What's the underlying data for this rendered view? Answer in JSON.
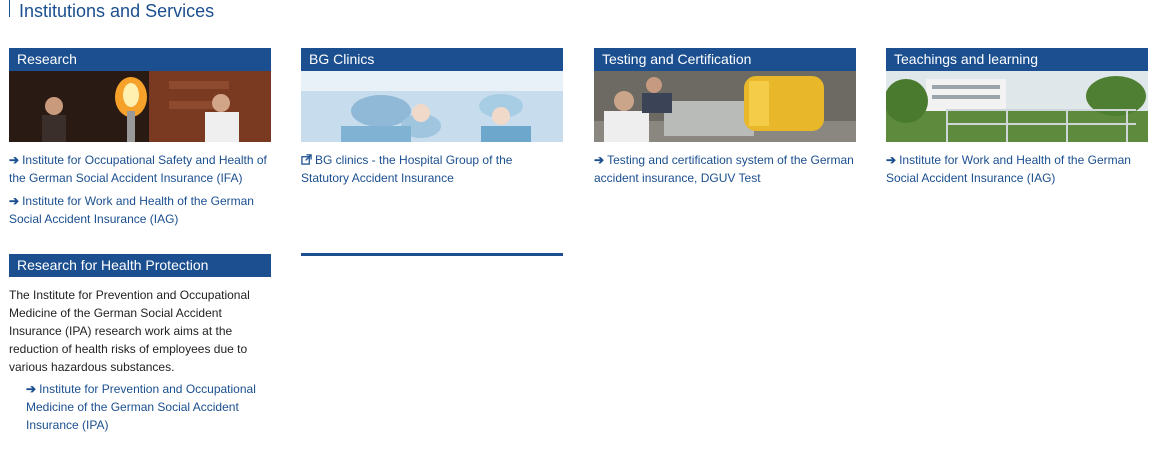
{
  "section": {
    "title": "Institutions and Services"
  },
  "cards": [
    {
      "title": "Research",
      "links": [
        "Institute for Occupational Safety and Health of the German Social Accident Insurance (IFA)",
        "Institute for Work and Health of the German Social Accident Insurance (IAG)"
      ]
    },
    {
      "title": "BG Clinics",
      "links": [
        "BG clinics - the Hospital Group of the Statutory Accident Insurance"
      ]
    },
    {
      "title": "Testing and Certification",
      "links": [
        "Testing and certification system of the German accident insurance, DGUV Test"
      ]
    },
    {
      "title": "Teachings and learning",
      "links": [
        "Institute for Work and Health of the German Social Accident Insurance (IAG)"
      ]
    }
  ],
  "health": {
    "title": "Research for Health Protection",
    "description": "The Institute for Prevention and Occupational Medicine of the German Social Accident Insurance (IPA) research work aims at the reduction of health risks of employees due to various hazardous substances.",
    "link": "Institute for Prevention and Occupational Medicine of the German Social Accident Insurance (IPA)"
  },
  "colors": {
    "brand": "#1b4f8f",
    "text": "#222222"
  },
  "icons": {
    "internal_link": "arrow-right-icon",
    "external_link": "external-link-icon"
  }
}
